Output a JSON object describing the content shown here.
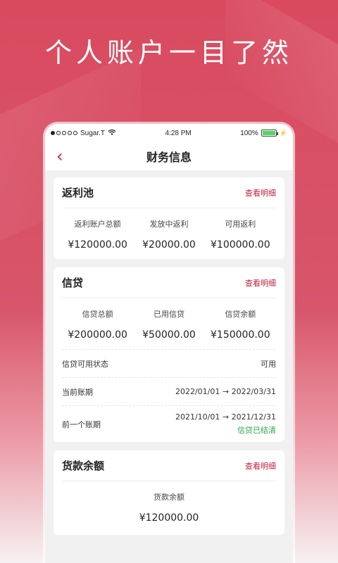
{
  "headline": "个人账户一目了然",
  "statusbar": {
    "carrier": "Sugar.T",
    "time": "4:28 PM",
    "battery": "100%",
    "battery_level": 1.0
  },
  "navbar": {
    "back_glyph": "‹",
    "title": "财务信息"
  },
  "rebate_pool": {
    "title": "返利池",
    "link": "查看明细",
    "stats": [
      {
        "label": "返利账户总额",
        "value": "¥120000.00"
      },
      {
        "label": "发放中返利",
        "value": "¥20000.00"
      },
      {
        "label": "可用返利",
        "value": "¥100000.00"
      }
    ]
  },
  "credit": {
    "title": "信贷",
    "link": "查看明细",
    "stats": [
      {
        "label": "信贷总额",
        "value": "¥200000.00"
      },
      {
        "label": "已用信贷",
        "value": "¥50000.00"
      },
      {
        "label": "信贷余额",
        "value": "¥150000.00"
      }
    ],
    "status_label": "信贷可用状态",
    "status_value": "可用",
    "current_period_label": "当前账期",
    "current_period_value": "2022/01/01 → 2022/03/31",
    "previous_period_label": "前一个账期",
    "previous_period_value": "2021/10/01 → 2021/12/31",
    "previous_period_status": "信贷已结清"
  },
  "loan_balance": {
    "title": "货款余额",
    "link": "查看明细",
    "label": "货款余额",
    "value": "¥120000.00"
  },
  "colors": {
    "accent": "#c21f3a",
    "background": "#d94a5f",
    "success": "#2aa84a"
  }
}
